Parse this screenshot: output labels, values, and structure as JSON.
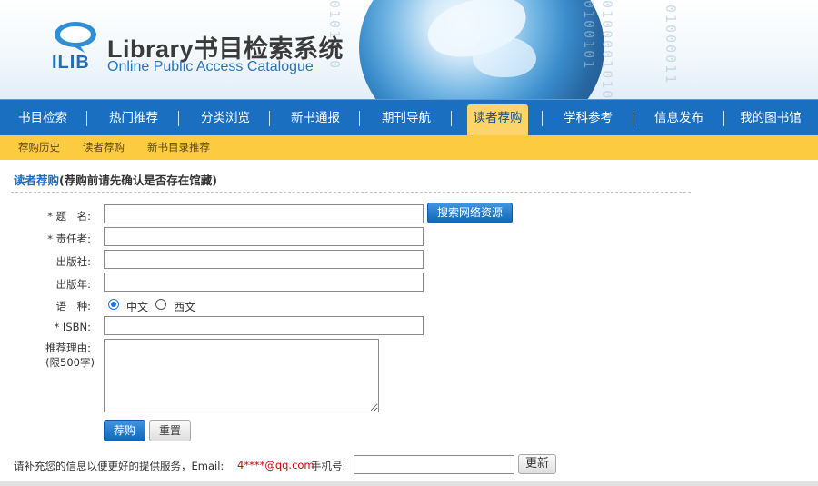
{
  "header": {
    "logo_text": "ILIB",
    "title": "Library书目检索系统",
    "subtitle": "Online Public Access Catalogue",
    "binary_1": "0101010",
    "binary_2": "0100101",
    "binary_3": "01000010100",
    "binary_4": "01000011"
  },
  "nav": {
    "items": [
      {
        "label": "书目检索"
      },
      {
        "label": "热门推荐"
      },
      {
        "label": "分类浏览"
      },
      {
        "label": "新书通报"
      },
      {
        "label": "期刊导航"
      },
      {
        "label": "读者荐购",
        "active": true
      },
      {
        "label": "学科参考"
      },
      {
        "label": "信息发布"
      },
      {
        "label": "我的图书馆"
      }
    ]
  },
  "subnav": {
    "items": [
      {
        "label": "荐购历史"
      },
      {
        "label": "读者荐购"
      },
      {
        "label": "新书目录推荐"
      }
    ]
  },
  "page": {
    "title_highlight": "读者荐购",
    "title_rest": "(荐购前请先确认是否存在馆藏)"
  },
  "form": {
    "title_label": "* 题　名:",
    "author_label": "* 责任者:",
    "publisher_label": "出版社:",
    "year_label": "出版年:",
    "language_label": "语　种:",
    "language_options": [
      "中文",
      "西文"
    ],
    "language_selected": "中文",
    "isbn_label": "* ISBN:",
    "reason_label": "推荐理由:",
    "reason_limit": "(限500字)",
    "title_value": "",
    "author_value": "",
    "publisher_value": "",
    "year_value": "",
    "isbn_value": "",
    "reason_value": "",
    "search_button": "搜索网络资源",
    "submit_button": "荐购",
    "reset_button": "重置"
  },
  "footer": {
    "info_text": "请补充您的信息以便更好的提供服务，Email:",
    "email": "4****@qq.com",
    "phone_label": "手机号:",
    "phone_value": "",
    "update_button": "更新"
  },
  "colors": {
    "nav_bg": "#1a6fc1",
    "subnav_bg": "#fccb3f",
    "active_tab": "#fcd46a",
    "accent_blue": "#1a6fc1",
    "email_red": "#d40000"
  }
}
